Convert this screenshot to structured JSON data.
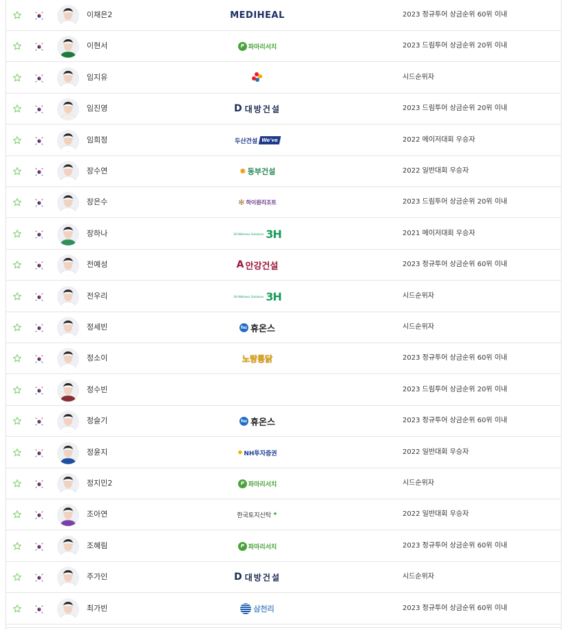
{
  "colors": {
    "star": "#7ccf6a",
    "row_border": "#e4e4e4",
    "text": "#333333"
  },
  "icons": {
    "favorite": "star-outline-icon",
    "nationality": "korea-flag-icon",
    "player": "player-photo-avatar"
  },
  "players": [
    {
      "name": "이채은2",
      "sponsor": "MEDIHEAL",
      "sponsor_style": "mediheal",
      "qualification": "2023 정규투어 상금순위 60위 이내"
    },
    {
      "name": "이현서",
      "sponsor": "파마리서치",
      "sponsor_style": "pama",
      "qualification": "2023 드림투어 상금순위 20위 이내"
    },
    {
      "name": "임지유",
      "sponsor": "CJ",
      "sponsor_style": "cj",
      "qualification": "시드순위자"
    },
    {
      "name": "임진영",
      "sponsor": "대방건설",
      "sponsor_style": "daebang",
      "qualification": "2023 드림투어 상금순위 20위 이내"
    },
    {
      "name": "임희정",
      "sponsor": "두산건설 We've",
      "sponsor_style": "doosan",
      "qualification": "2022 메이저대회 우승자"
    },
    {
      "name": "장수연",
      "sponsor": "동부건설",
      "sponsor_style": "dongbu",
      "qualification": "2022 일반대회 우승자"
    },
    {
      "name": "장은수",
      "sponsor": "하이원리조트",
      "sponsor_style": "high1",
      "qualification": "2023 드림투어 상금순위 20위 이내"
    },
    {
      "name": "장하나",
      "sponsor": "3H Wellness Solutions",
      "sponsor_style": "3h",
      "qualification": "2021 메이저대회 우승자"
    },
    {
      "name": "전예성",
      "sponsor": "안강건설",
      "sponsor_style": "angang",
      "qualification": "2023 정규투어 상금순위 60위 이내"
    },
    {
      "name": "전우리",
      "sponsor": "3H Wellness Solutions",
      "sponsor_style": "3h",
      "qualification": "시드순위자"
    },
    {
      "name": "정세빈",
      "sponsor": "휴온스",
      "sponsor_style": "huons",
      "qualification": "시드순위자"
    },
    {
      "name": "정소이",
      "sponsor": "노랑통닭",
      "sponsor_style": "nosang",
      "qualification": "2023 정규투어 상금순위 60위 이내"
    },
    {
      "name": "정수빈",
      "sponsor": "",
      "sponsor_style": "none",
      "qualification": "2023 드림투어 상금순위 20위 이내"
    },
    {
      "name": "정슬기",
      "sponsor": "휴온스",
      "sponsor_style": "huons",
      "qualification": "2023 정규투어 상금순위 60위 이내"
    },
    {
      "name": "정윤지",
      "sponsor": "NH투자증권",
      "sponsor_style": "nh",
      "qualification": "2022 일반대회 우승자"
    },
    {
      "name": "정지민2",
      "sponsor": "파마리서치",
      "sponsor_style": "pama",
      "qualification": "시드순위자"
    },
    {
      "name": "조아연",
      "sponsor": "한국토지신탁",
      "sponsor_style": "koreit",
      "qualification": "2022 일반대회 우승자"
    },
    {
      "name": "조혜림",
      "sponsor": "파마리서치",
      "sponsor_style": "pama",
      "qualification": "2023 정규투어 상금순위 60위 이내"
    },
    {
      "name": "주가인",
      "sponsor": "대방건설",
      "sponsor_style": "daebang",
      "qualification": "시드순위자"
    },
    {
      "name": "최가빈",
      "sponsor": "삼천리",
      "sponsor_style": "samchully",
      "qualification": "2023 정규투어 상금순위 60위 이내"
    }
  ]
}
